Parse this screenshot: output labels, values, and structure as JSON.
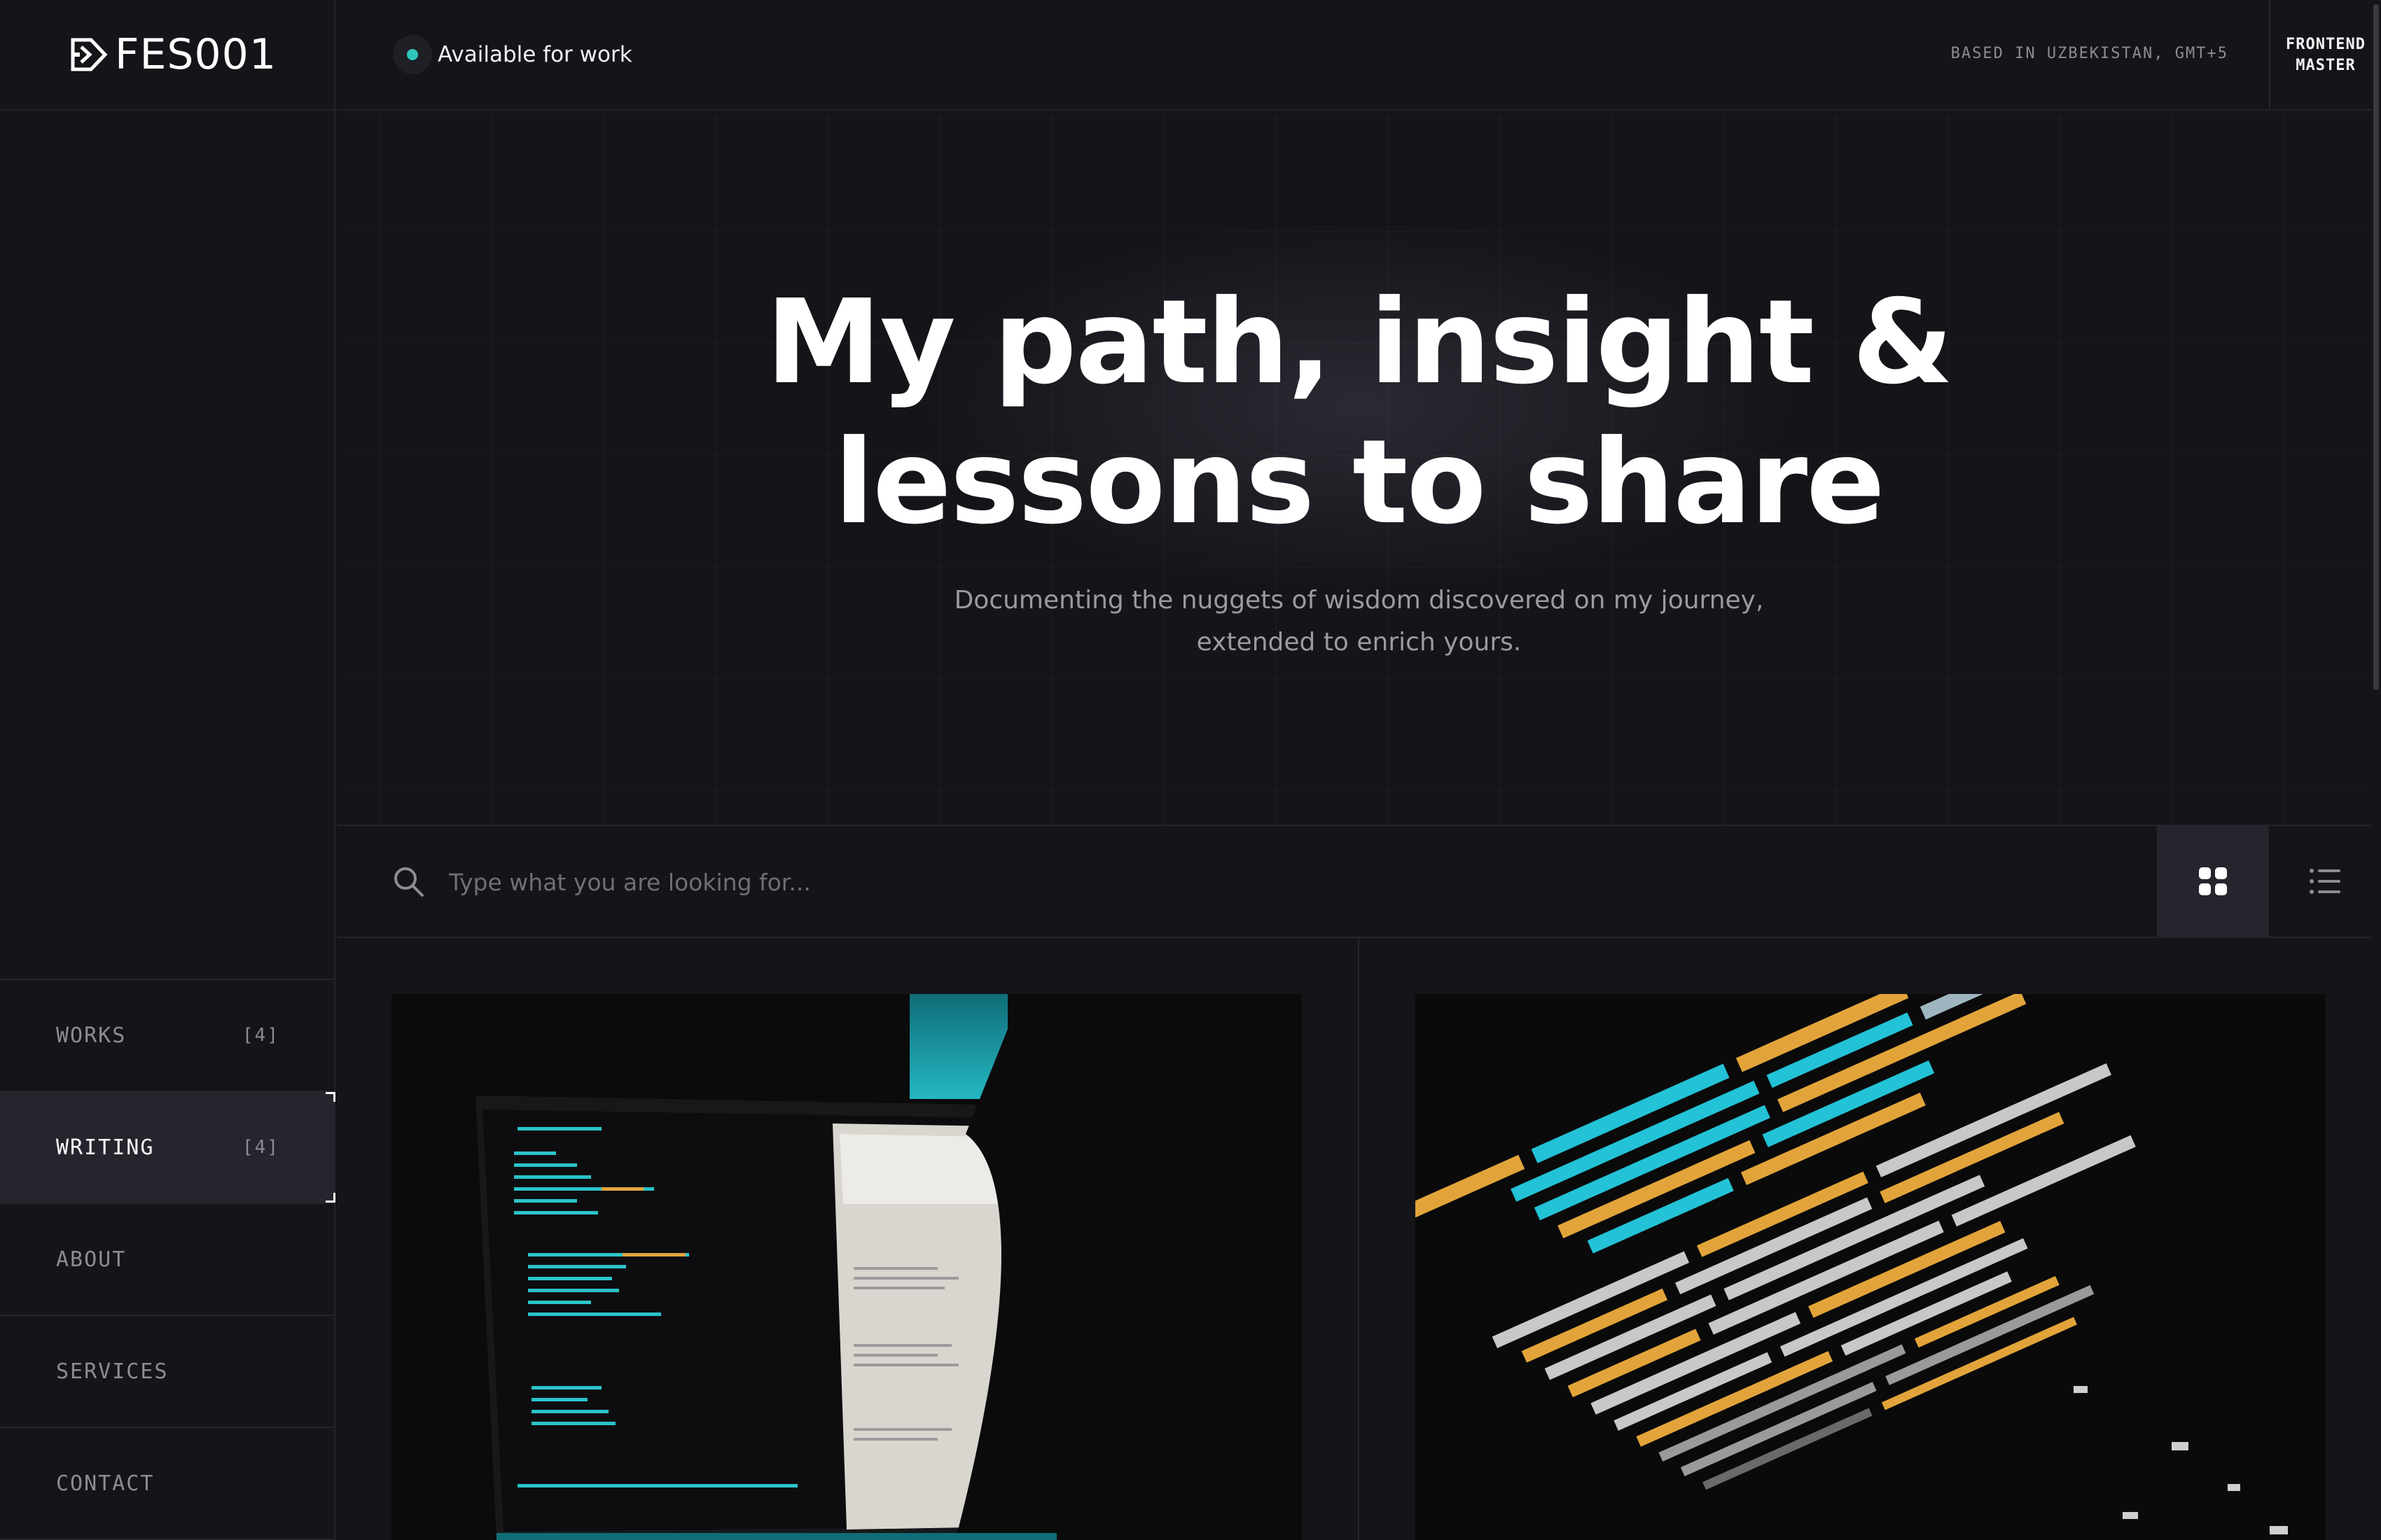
{
  "brand": {
    "logo_text": "FES001"
  },
  "header": {
    "availability": "Available for work",
    "location": "BASED IN UZBEKISTAN, GMT+5",
    "badge_line1": "FRONTEND",
    "badge_line2": "MASTER"
  },
  "hero": {
    "title_line1": "My path, insight &",
    "title_line2": "lessons to share",
    "subtitle_line1": "Documenting the nuggets of wisdom discovered on my journey,",
    "subtitle_line2": "extended to enrich yours."
  },
  "search": {
    "placeholder": "Type what you are looking for..."
  },
  "nav": {
    "items": [
      {
        "label": "WORKS",
        "count": "[4]"
      },
      {
        "label": "WRITING",
        "count": "[4]"
      },
      {
        "label": "ABOUT",
        "count": ""
      },
      {
        "label": "SERVICES",
        "count": ""
      },
      {
        "label": "CONTACT",
        "count": ""
      }
    ]
  },
  "colors": {
    "background": "#141419",
    "accent": "#2fc6bd",
    "active_nav": "#25252d",
    "muted_text": "#8c8c95",
    "code_orange": "#e2a43a",
    "code_cyan": "#23c2d6"
  },
  "icons": {
    "search": "search-icon",
    "grid_view": "grid-view-icon",
    "list_view": "list-view-icon",
    "logo": "logo-mark-icon"
  }
}
